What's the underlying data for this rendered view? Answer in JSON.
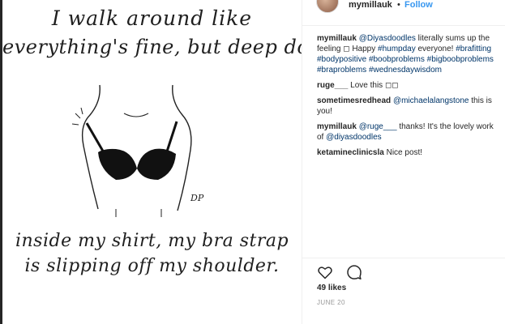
{
  "post_image": {
    "line1": "I walk around like",
    "line2": "everything's fine, but deep down,",
    "line3": "inside my shirt, my bra strap",
    "line4": "is slipping off my shoulder.",
    "signature": "DP"
  },
  "header": {
    "username": "mymillauk",
    "separator": "•",
    "follow_label": "Follow"
  },
  "comments": [
    {
      "user": "mymillauk",
      "parts": [
        {
          "t": "@Diyasdoodles",
          "link": true
        },
        {
          "t": " literally sums up the feeling ◻ Happy ",
          "link": false
        },
        {
          "t": "#humpday",
          "link": true
        },
        {
          "t": " everyone! ",
          "link": false
        },
        {
          "t": "#brafitting",
          "link": true
        },
        {
          "t": " ",
          "link": false
        },
        {
          "t": "#bodypositive",
          "link": true
        },
        {
          "t": " ",
          "link": false
        },
        {
          "t": "#boobproblems",
          "link": true
        },
        {
          "t": " ",
          "link": false
        },
        {
          "t": "#bigboobproblems",
          "link": true
        },
        {
          "t": " ",
          "link": false
        },
        {
          "t": "#braproblems",
          "link": true
        },
        {
          "t": " ",
          "link": false
        },
        {
          "t": "#wednesdaywisdom",
          "link": true
        }
      ]
    },
    {
      "user": "ruge___",
      "parts": [
        {
          "t": "Love this ◻◻",
          "link": false
        }
      ]
    },
    {
      "user": "sometimesredhead",
      "parts": [
        {
          "t": "@michaelalangstone",
          "link": true
        },
        {
          "t": " this is you!",
          "link": false
        }
      ]
    },
    {
      "user": "mymillauk",
      "parts": [
        {
          "t": "@ruge___",
          "link": true
        },
        {
          "t": " thanks! It's the lovely work of ",
          "link": false
        },
        {
          "t": "@diyasdoodles",
          "link": true
        }
      ]
    },
    {
      "user": "ketamineclinicsla",
      "parts": [
        {
          "t": "Nice post!",
          "link": false
        }
      ]
    }
  ],
  "actions": {
    "like_icon": "heart-icon",
    "comment_icon": "comment-bubble-icon",
    "likes_text": "49 likes",
    "date_text": "JUNE 20"
  },
  "colors": {
    "link": "#003569",
    "follow": "#3897f0",
    "text": "#262626",
    "muted": "#999999"
  }
}
